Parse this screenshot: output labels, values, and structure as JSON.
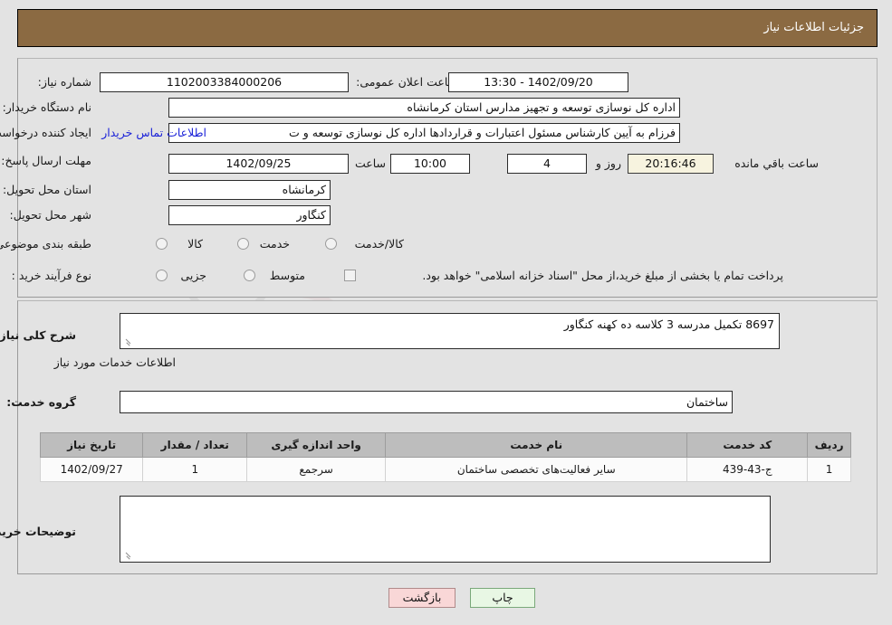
{
  "header": {
    "title": "جزئیات اطلاعات نیاز"
  },
  "top_form": {
    "need_number_label": "شماره نیاز:",
    "need_number_value": "1102003384000206",
    "announce_datetime_label": "تاریخ و ساعت اعلان عمومی:",
    "announce_datetime_value": "13:30 - 1402/09/20",
    "buyer_org_label": "نام دستگاه خریدار:",
    "buyer_org_value": "اداره کل نوسازی  توسعه و تجهیز مدارس استان کرمانشاه",
    "requester_label": "ایجاد کننده درخواست:",
    "requester_value": "فرزام به آیین کارشناس مسئول اعتبارات و قراردادها اداره کل نوسازی  توسعه و ت",
    "contact_link": "اطلاعات تماس خریدار",
    "deadline_label": "مهلت ارسال پاسخ: تا تاریخ:",
    "deadline_date": "1402/09/25",
    "deadline_hour_label": "ساعت",
    "deadline_hour_value": "10:00",
    "remaining_days_value": "4",
    "remaining_days_label": "روز و",
    "remaining_time_value": "20:16:46",
    "remaining_time_label": "ساعت باقي مانده",
    "province_label": "استان محل تحویل:",
    "province_value": "کرمانشاه",
    "city_label": "شهر محل تحویل:",
    "city_value": "کنگاور",
    "category_label": "طبقه بندی موضوعی:",
    "category_options": [
      {
        "label": "کالا",
        "selected": false
      },
      {
        "label": "خدمت",
        "selected": false
      },
      {
        "label": "کالا/خدمت",
        "selected": false
      }
    ],
    "process_type_label": "نوع فرآیند خرید :",
    "process_type_options": [
      {
        "label": "جزیی",
        "selected": false
      },
      {
        "label": "متوسط",
        "selected": false
      }
    ],
    "treasury_checkbox_label": "پرداخت تمام یا بخشی از مبلغ خرید،از محل \"اسناد خزانه اسلامی\" خواهد بود.",
    "treasury_checkbox_checked": false
  },
  "middle": {
    "general_desc_label": "شرح کلی نیاز:",
    "general_desc_value": "8697 تکمیل مدرسه 3 کلاسه ده کهنه کنگاور",
    "services_heading": "اطلاعات خدمات مورد نیاز",
    "service_group_label": "گروه خدمت:",
    "service_group_value": "ساختمان",
    "buyer_notes_label": "توضیحات خریدار:",
    "buyer_notes_value": ""
  },
  "table": {
    "columns": [
      "ردیف",
      "کد خدمت",
      "نام خدمت",
      "واحد اندازه گیری",
      "تعداد / مقدار",
      "تاریخ نیاز"
    ],
    "rows": [
      {
        "row_no": "1",
        "service_code": "ج-43-439",
        "service_name": "سایر فعالیت‌های تخصصی ساختمان",
        "unit": "سرجمع",
        "quantity": "1",
        "need_date": "1402/09/27"
      }
    ]
  },
  "footer": {
    "back_label": "بازگشت",
    "print_label": "چاپ"
  },
  "watermark": {
    "text": "AnaTender.net"
  },
  "colors": {
    "header_bg": "#8b6a42",
    "page_bg": "#e3e3e3",
    "link": "#1b22d8",
    "table_header_bg": "#bdbdbd",
    "back_btn_bg": "#f9d7d7",
    "print_btn_bg": "#e8f7e4",
    "countdown_bg": "#f7f3df"
  }
}
